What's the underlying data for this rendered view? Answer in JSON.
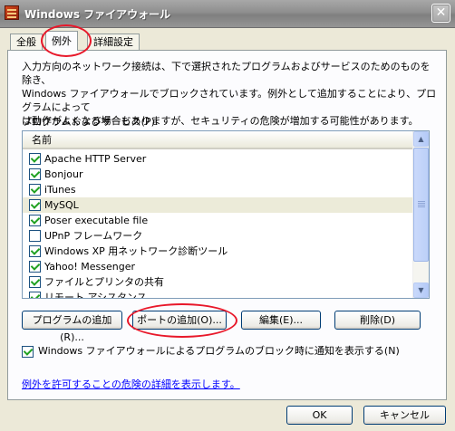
{
  "window": {
    "title": "Windows ファイアウォール",
    "close_glyph": "✕"
  },
  "tabs": [
    {
      "label": "全般"
    },
    {
      "label": "例外"
    },
    {
      "label": "詳細設定"
    }
  ],
  "description": [
    "入力方向のネットワーク接続は、下で選択されたプログラムおよびサービスのためのものを除き、",
    "Windows ファイアウォールでブロックされています。例外として追加することにより、プログラムによって",
    "は動作がよくなる場合もありますが、セキュリティの危険が増加する可能性があります。"
  ],
  "programs": {
    "label": "プログラムおよびサービス(P):",
    "column_header": "名前",
    "items": [
      {
        "label": "Apache HTTP Server",
        "checked": true
      },
      {
        "label": "Bonjour",
        "checked": true
      },
      {
        "label": "iTunes",
        "checked": true
      },
      {
        "label": "MySQL",
        "checked": true,
        "selected": true
      },
      {
        "label": "Poser executable file",
        "checked": true
      },
      {
        "label": "UPnP フレームワーク",
        "checked": false
      },
      {
        "label": "Windows XP 用ネットワーク診断ツール",
        "checked": true
      },
      {
        "label": "Yahoo! Messenger",
        "checked": true
      },
      {
        "label": "ファイルとプリンタの共有",
        "checked": true
      },
      {
        "label": "リモート アシスタンス",
        "checked": true
      }
    ],
    "scroll_up": "▲",
    "scroll_down": "▼"
  },
  "buttons": {
    "add_program": "プログラムの追加(R)...",
    "add_port": "ポートの追加(O)...",
    "edit": "編集(E)...",
    "delete": "削除(D)",
    "ok": "OK",
    "cancel": "キャンセル"
  },
  "notify": {
    "label": "Windows ファイアウォールによるプログラムのブロック時に通知を表示する(N)",
    "checked": true
  },
  "link": "例外を許可することの危険の詳細を表示します。",
  "annotation_color": "#E8182A"
}
